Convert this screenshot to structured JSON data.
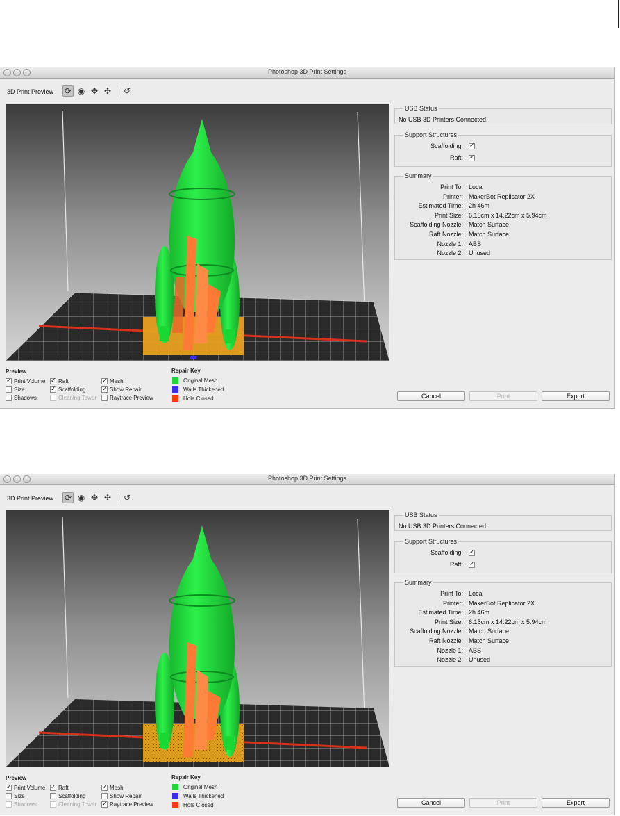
{
  "window_title": "Photoshop 3D Print Settings",
  "toolbar": {
    "label": "3D Print Preview"
  },
  "usb_status": {
    "title": "USB Status",
    "text": "No USB 3D Printers Connected."
  },
  "support_structures": {
    "title": "Support Structures",
    "items": [
      {
        "label": "Scaffolding:",
        "checked": true
      },
      {
        "label": "Raft:",
        "checked": true
      }
    ]
  },
  "summary": {
    "title": "Summary",
    "rows": [
      {
        "label": "Print To:",
        "value": "Local"
      },
      {
        "label": "Printer:",
        "value": "MakerBot Replicator 2X"
      },
      {
        "label": "Estimated Time:",
        "value": "2h 46m"
      },
      {
        "label": "Print Size:",
        "value": "6.15cm x 14.22cm x 5.94cm"
      },
      {
        "label": "Scaffolding Nozzle:",
        "value": "Match Surface"
      },
      {
        "label": "Raft Nozzle:",
        "value": "Match Surface"
      },
      {
        "label": "Nozzle 1:",
        "value": "ABS"
      },
      {
        "label": "Nozzle 2:",
        "value": "Unused"
      }
    ]
  },
  "preview": {
    "title": "Preview",
    "options": [
      {
        "label": "Print Volume",
        "checked": true,
        "enabled": true
      },
      {
        "label": "Size",
        "checked": false,
        "enabled": true
      },
      {
        "label": "Shadows",
        "checked": false,
        "enabled": true
      },
      {
        "label": "Raft",
        "checked": true,
        "enabled": true
      },
      {
        "label": "Scaffolding",
        "checked": true,
        "enabled": true
      },
      {
        "label": "Cleaning Tower",
        "checked": false,
        "enabled": false
      },
      {
        "label": "Mesh",
        "checked": true,
        "enabled": true
      },
      {
        "label": "Show Repair",
        "checked": true,
        "enabled": true
      },
      {
        "label": "Raytrace Preview",
        "checked": false,
        "enabled": true
      }
    ],
    "options_second": [
      {
        "label": "Print Volume",
        "checked": true,
        "enabled": true
      },
      {
        "label": "Size",
        "checked": false,
        "enabled": true
      },
      {
        "label": "Shadows",
        "checked": false,
        "enabled": false
      },
      {
        "label": "Raft",
        "checked": true,
        "enabled": true
      },
      {
        "label": "Scaffolding",
        "checked": false,
        "enabled": true
      },
      {
        "label": "Cleaning Tower",
        "checked": false,
        "enabled": false
      },
      {
        "label": "Mesh",
        "checked": true,
        "enabled": true
      },
      {
        "label": "Show Repair",
        "checked": false,
        "enabled": true
      },
      {
        "label": "Raytrace Preview",
        "checked": true,
        "enabled": true
      }
    ]
  },
  "repair_key": {
    "title": "Repair Key",
    "items": [
      {
        "label": "Original Mesh",
        "color": "#22d63a"
      },
      {
        "label": "Walls Thickened",
        "color": "#3b2cf0"
      },
      {
        "label": "Hole Closed",
        "color": "#ff3a10"
      }
    ]
  },
  "buttons": {
    "cancel": "Cancel",
    "print": "Print",
    "export": "Export"
  },
  "colors": {
    "mesh": "#1fe63d",
    "scaffolding": "#ff7a35",
    "raft": "#e8a020",
    "grid_edge": "#d8301a"
  }
}
